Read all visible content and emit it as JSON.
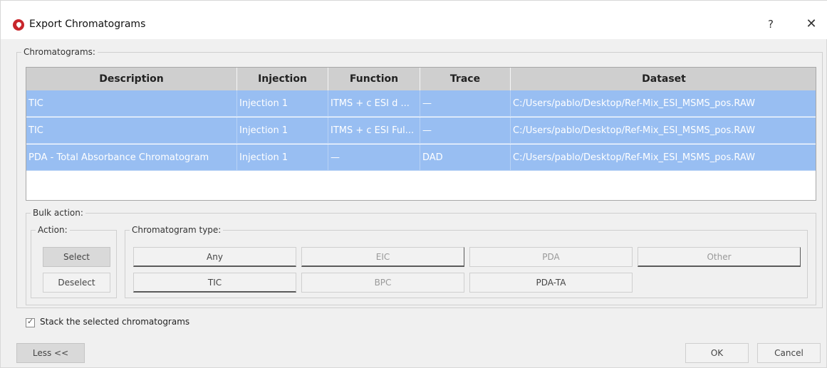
{
  "window": {
    "title": "Export Chromatograms",
    "help_glyph": "?",
    "close_glyph": "✕",
    "app_icon": "brand-logo-icon"
  },
  "chromatograms": {
    "group_title": "Chromatograms:",
    "columns": [
      "Description",
      "Injection",
      "Function",
      "Trace",
      "Dataset"
    ],
    "rows": [
      [
        "TIC",
        "Injection 1",
        "ITMS + c ESI d ...",
        "—",
        "C:/Users/pablo/Desktop/Ref-Mix_ESI_MSMS_pos.RAW"
      ],
      [
        "TIC",
        "Injection 1",
        "ITMS + c ESI Ful...",
        "—",
        "C:/Users/pablo/Desktop/Ref-Mix_ESI_MSMS_pos.RAW"
      ],
      [
        "PDA - Total Absorbance Chromatogram",
        "Injection 1",
        "—",
        "DAD",
        "C:/Users/pablo/Desktop/Ref-Mix_ESI_MSMS_pos.RAW"
      ]
    ]
  },
  "bulk_action": {
    "group_title": "Bulk action:",
    "action": {
      "group_title": "Action:",
      "select": "Select",
      "deselect": "Deselect"
    },
    "type": {
      "group_title": "Chromatogram type:",
      "any": "Any",
      "eic": "EIC",
      "pda": "PDA",
      "other": "Other",
      "tic": "TIC",
      "bpc": "BPC",
      "pda_ta": "PDA-TA"
    }
  },
  "stack": {
    "label": "Stack the selected chromatograms",
    "checked": true
  },
  "footer": {
    "less": "Less <<",
    "ok": "OK",
    "cancel": "Cancel"
  },
  "colors": {
    "selection": "#98bef2",
    "header": "#cfcfcf",
    "brand": "#c8262c"
  }
}
